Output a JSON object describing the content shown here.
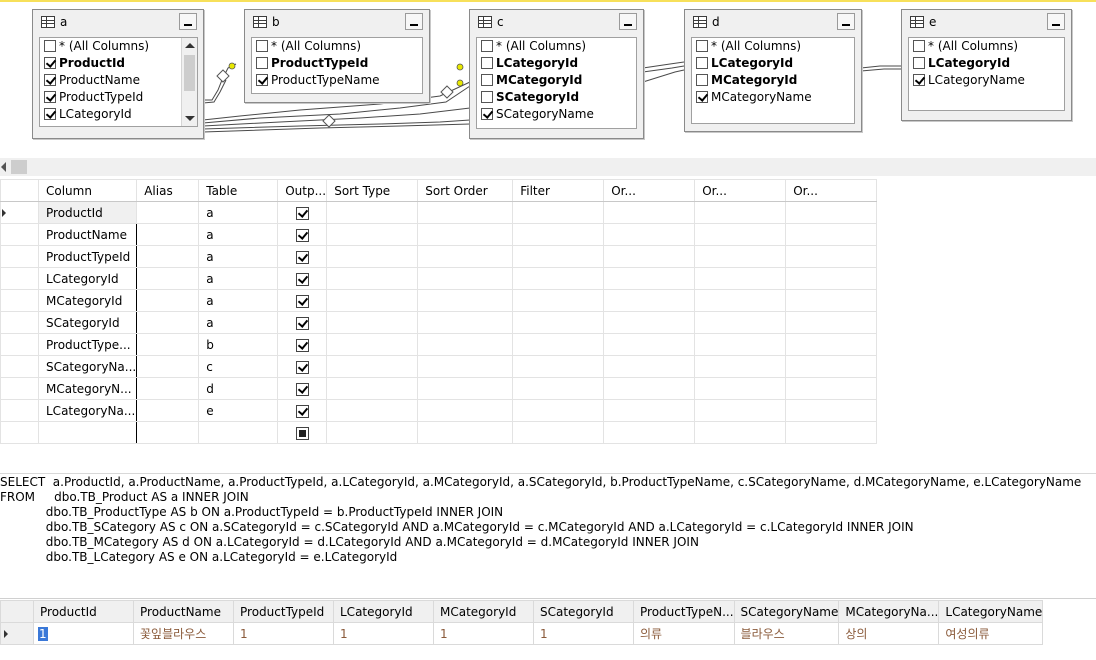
{
  "diagram": {
    "tables": [
      {
        "alias": "a",
        "columns": [
          {
            "name": "* (All Columns)",
            "checked": false,
            "key": false
          },
          {
            "name": "ProductId",
            "checked": true,
            "key": true
          },
          {
            "name": "ProductName",
            "checked": true,
            "key": false
          },
          {
            "name": "ProductTypeId",
            "checked": true,
            "key": false
          },
          {
            "name": "LCategoryId",
            "checked": true,
            "key": false
          }
        ]
      },
      {
        "alias": "b",
        "columns": [
          {
            "name": "* (All Columns)",
            "checked": false,
            "key": false
          },
          {
            "name": "ProductTypeId",
            "checked": false,
            "key": true
          },
          {
            "name": "ProductTypeName",
            "checked": true,
            "key": false
          }
        ]
      },
      {
        "alias": "c",
        "columns": [
          {
            "name": "* (All Columns)",
            "checked": false,
            "key": false
          },
          {
            "name": "LCategoryId",
            "checked": false,
            "key": true
          },
          {
            "name": "MCategoryId",
            "checked": false,
            "key": true
          },
          {
            "name": "SCategoryId",
            "checked": false,
            "key": true
          },
          {
            "name": "SCategoryName",
            "checked": true,
            "key": false
          }
        ]
      },
      {
        "alias": "d",
        "columns": [
          {
            "name": "* (All Columns)",
            "checked": false,
            "key": false
          },
          {
            "name": "LCategoryId",
            "checked": false,
            "key": true
          },
          {
            "name": "MCategoryId",
            "checked": false,
            "key": true
          },
          {
            "name": "MCategoryName",
            "checked": true,
            "key": false
          }
        ]
      },
      {
        "alias": "e",
        "columns": [
          {
            "name": "* (All Columns)",
            "checked": false,
            "key": false
          },
          {
            "name": "LCategoryId",
            "checked": false,
            "key": true
          },
          {
            "name": "LCategoryName",
            "checked": true,
            "key": false
          }
        ]
      }
    ]
  },
  "criteria": {
    "headers": [
      "Column",
      "Alias",
      "Table",
      "Outp...",
      "Sort Type",
      "Sort Order",
      "Filter",
      "Or...",
      "Or...",
      "Or..."
    ],
    "rows": [
      {
        "column": "ProductId",
        "alias": "",
        "table": "a",
        "output": true
      },
      {
        "column": "ProductName",
        "alias": "",
        "table": "a",
        "output": true
      },
      {
        "column": "ProductTypeId",
        "alias": "",
        "table": "a",
        "output": true
      },
      {
        "column": "LCategoryId",
        "alias": "",
        "table": "a",
        "output": true
      },
      {
        "column": "MCategoryId",
        "alias": "",
        "table": "a",
        "output": true
      },
      {
        "column": "SCategoryId",
        "alias": "",
        "table": "a",
        "output": true
      },
      {
        "column": "ProductType...",
        "alias": "",
        "table": "b",
        "output": true
      },
      {
        "column": "SCategoryNa...",
        "alias": "",
        "table": "c",
        "output": true
      },
      {
        "column": "MCategoryN...",
        "alias": "",
        "table": "d",
        "output": true
      },
      {
        "column": "LCategoryNa...",
        "alias": "",
        "table": "e",
        "output": true
      }
    ]
  },
  "sql": {
    "lines": [
      "SELECT  a.ProductId, a.ProductName, a.ProductTypeId, a.LCategoryId, a.MCategoryId, a.SCategoryId, b.ProductTypeName, c.SCategoryName, d.MCategoryName, e.LCategoryName",
      "FROM     dbo.TB_Product AS a INNER JOIN",
      "            dbo.TB_ProductType AS b ON a.ProductTypeId = b.ProductTypeId INNER JOIN",
      "            dbo.TB_SCategory AS c ON a.SCategoryId = c.SCategoryId AND a.MCategoryId = c.MCategoryId AND a.LCategoryId = c.LCategoryId INNER JOIN",
      "            dbo.TB_MCategory AS d ON a.LCategoryId = d.LCategoryId AND a.MCategoryId = d.MCategoryId INNER JOIN",
      "            dbo.TB_LCategory AS e ON a.LCategoryId = e.LCategoryId"
    ]
  },
  "results": {
    "headers": [
      "ProductId",
      "ProductName",
      "ProductTypeId",
      "LCategoryId",
      "MCategoryId",
      "SCategoryId",
      "ProductTypeN...",
      "SCategoryName",
      "MCategoryNa...",
      "LCategoryName"
    ],
    "rows": [
      [
        "1",
        "꽃잎블라우스",
        "1",
        "1",
        "1",
        "1",
        "의류",
        "블라우스",
        "상의",
        "여성의류"
      ]
    ]
  }
}
